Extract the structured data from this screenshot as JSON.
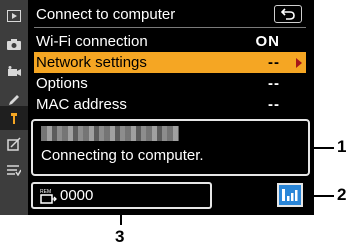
{
  "menu": {
    "title": "Connect to computer",
    "rows": [
      {
        "label": "Wi-Fi connection",
        "value": "ON"
      },
      {
        "label": "Network settings",
        "value": "--"
      },
      {
        "label": "Options",
        "value": "--"
      },
      {
        "label": "MAC address",
        "value": "--"
      }
    ]
  },
  "status": {
    "message": "Connecting to computer."
  },
  "counter": {
    "value": "0000"
  },
  "callouts": [
    "1",
    "2",
    "3"
  ],
  "colors": {
    "highlight": "#f5a623",
    "screen": "#000000",
    "sidebar": "#3d3d3d",
    "signal": "#2a86d8"
  },
  "sidebar_icons": [
    "playback-icon",
    "camera-icon",
    "movie-icon",
    "pencil-icon",
    "wrench-icon",
    "retouch-icon",
    "my-menu-icon"
  ]
}
